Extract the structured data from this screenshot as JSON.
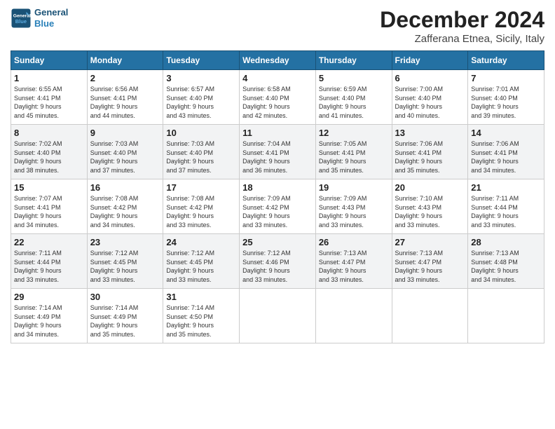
{
  "header": {
    "logo_line1": "General",
    "logo_line2": "Blue",
    "month": "December 2024",
    "location": "Zafferana Etnea, Sicily, Italy"
  },
  "weekdays": [
    "Sunday",
    "Monday",
    "Tuesday",
    "Wednesday",
    "Thursday",
    "Friday",
    "Saturday"
  ],
  "weeks": [
    [
      {
        "day": "1",
        "info": "Sunrise: 6:55 AM\nSunset: 4:41 PM\nDaylight: 9 hours\nand 45 minutes."
      },
      {
        "day": "2",
        "info": "Sunrise: 6:56 AM\nSunset: 4:41 PM\nDaylight: 9 hours\nand 44 minutes."
      },
      {
        "day": "3",
        "info": "Sunrise: 6:57 AM\nSunset: 4:40 PM\nDaylight: 9 hours\nand 43 minutes."
      },
      {
        "day": "4",
        "info": "Sunrise: 6:58 AM\nSunset: 4:40 PM\nDaylight: 9 hours\nand 42 minutes."
      },
      {
        "day": "5",
        "info": "Sunrise: 6:59 AM\nSunset: 4:40 PM\nDaylight: 9 hours\nand 41 minutes."
      },
      {
        "day": "6",
        "info": "Sunrise: 7:00 AM\nSunset: 4:40 PM\nDaylight: 9 hours\nand 40 minutes."
      },
      {
        "day": "7",
        "info": "Sunrise: 7:01 AM\nSunset: 4:40 PM\nDaylight: 9 hours\nand 39 minutes."
      }
    ],
    [
      {
        "day": "8",
        "info": "Sunrise: 7:02 AM\nSunset: 4:40 PM\nDaylight: 9 hours\nand 38 minutes."
      },
      {
        "day": "9",
        "info": "Sunrise: 7:03 AM\nSunset: 4:40 PM\nDaylight: 9 hours\nand 37 minutes."
      },
      {
        "day": "10",
        "info": "Sunrise: 7:03 AM\nSunset: 4:40 PM\nDaylight: 9 hours\nand 37 minutes."
      },
      {
        "day": "11",
        "info": "Sunrise: 7:04 AM\nSunset: 4:41 PM\nDaylight: 9 hours\nand 36 minutes."
      },
      {
        "day": "12",
        "info": "Sunrise: 7:05 AM\nSunset: 4:41 PM\nDaylight: 9 hours\nand 35 minutes."
      },
      {
        "day": "13",
        "info": "Sunrise: 7:06 AM\nSunset: 4:41 PM\nDaylight: 9 hours\nand 35 minutes."
      },
      {
        "day": "14",
        "info": "Sunrise: 7:06 AM\nSunset: 4:41 PM\nDaylight: 9 hours\nand 34 minutes."
      }
    ],
    [
      {
        "day": "15",
        "info": "Sunrise: 7:07 AM\nSunset: 4:41 PM\nDaylight: 9 hours\nand 34 minutes."
      },
      {
        "day": "16",
        "info": "Sunrise: 7:08 AM\nSunset: 4:42 PM\nDaylight: 9 hours\nand 34 minutes."
      },
      {
        "day": "17",
        "info": "Sunrise: 7:08 AM\nSunset: 4:42 PM\nDaylight: 9 hours\nand 33 minutes."
      },
      {
        "day": "18",
        "info": "Sunrise: 7:09 AM\nSunset: 4:42 PM\nDaylight: 9 hours\nand 33 minutes."
      },
      {
        "day": "19",
        "info": "Sunrise: 7:09 AM\nSunset: 4:43 PM\nDaylight: 9 hours\nand 33 minutes."
      },
      {
        "day": "20",
        "info": "Sunrise: 7:10 AM\nSunset: 4:43 PM\nDaylight: 9 hours\nand 33 minutes."
      },
      {
        "day": "21",
        "info": "Sunrise: 7:11 AM\nSunset: 4:44 PM\nDaylight: 9 hours\nand 33 minutes."
      }
    ],
    [
      {
        "day": "22",
        "info": "Sunrise: 7:11 AM\nSunset: 4:44 PM\nDaylight: 9 hours\nand 33 minutes."
      },
      {
        "day": "23",
        "info": "Sunrise: 7:12 AM\nSunset: 4:45 PM\nDaylight: 9 hours\nand 33 minutes."
      },
      {
        "day": "24",
        "info": "Sunrise: 7:12 AM\nSunset: 4:45 PM\nDaylight: 9 hours\nand 33 minutes."
      },
      {
        "day": "25",
        "info": "Sunrise: 7:12 AM\nSunset: 4:46 PM\nDaylight: 9 hours\nand 33 minutes."
      },
      {
        "day": "26",
        "info": "Sunrise: 7:13 AM\nSunset: 4:47 PM\nDaylight: 9 hours\nand 33 minutes."
      },
      {
        "day": "27",
        "info": "Sunrise: 7:13 AM\nSunset: 4:47 PM\nDaylight: 9 hours\nand 33 minutes."
      },
      {
        "day": "28",
        "info": "Sunrise: 7:13 AM\nSunset: 4:48 PM\nDaylight: 9 hours\nand 34 minutes."
      }
    ],
    [
      {
        "day": "29",
        "info": "Sunrise: 7:14 AM\nSunset: 4:49 PM\nDaylight: 9 hours\nand 34 minutes."
      },
      {
        "day": "30",
        "info": "Sunrise: 7:14 AM\nSunset: 4:49 PM\nDaylight: 9 hours\nand 35 minutes."
      },
      {
        "day": "31",
        "info": "Sunrise: 7:14 AM\nSunset: 4:50 PM\nDaylight: 9 hours\nand 35 minutes."
      },
      null,
      null,
      null,
      null
    ]
  ]
}
